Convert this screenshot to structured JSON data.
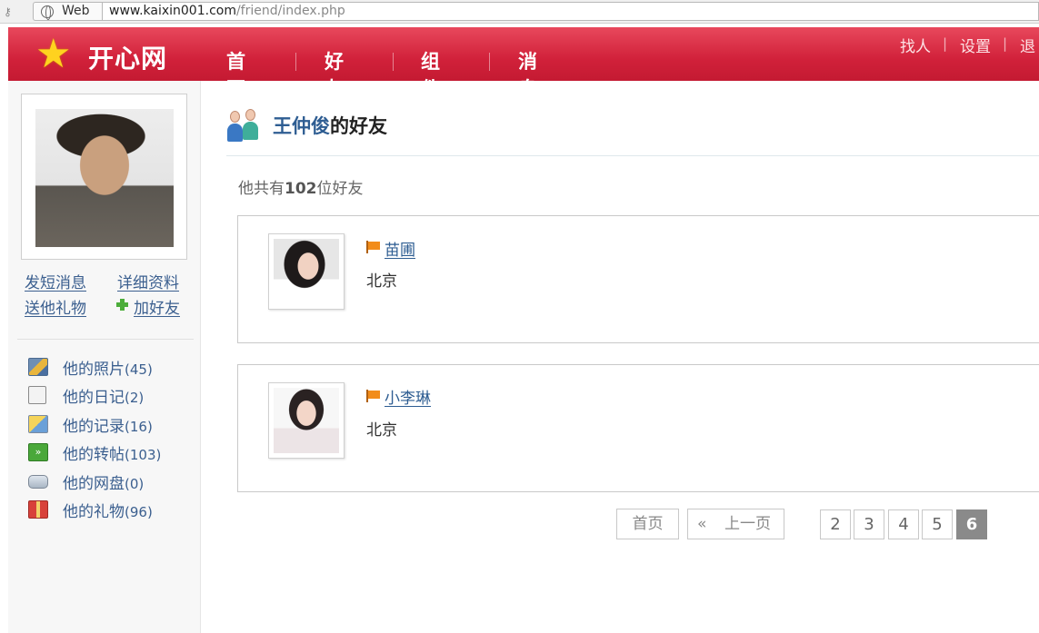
{
  "browser": {
    "mode_label": "Web",
    "url_host": "www.kaixin001.com",
    "url_path": "/friend/index.php"
  },
  "header": {
    "logo_text": "开心网",
    "nav": [
      "首页",
      "好友",
      "组件",
      "消息"
    ],
    "top_links": [
      "找人",
      "设置",
      "退"
    ],
    "colors": {
      "header_red": "#d1213a",
      "link_blue": "#2e5d92"
    }
  },
  "sidebar": {
    "actions": {
      "message": "发短消息",
      "profile": "详细资料",
      "gift": "送他礼物",
      "add_friend": "加好友"
    },
    "menu": [
      {
        "label": "他的照片",
        "count": "(45)",
        "icon": "photo-icon"
      },
      {
        "label": "他的日记",
        "count": "(2)",
        "icon": "diary-icon"
      },
      {
        "label": "他的记录",
        "count": "(16)",
        "icon": "record-icon"
      },
      {
        "label": "他的转帖",
        "count": "(103)",
        "icon": "repost-icon"
      },
      {
        "label": "他的网盘",
        "count": "(0)",
        "icon": "netdisk-icon"
      },
      {
        "label": "他的礼物",
        "count": "(96)",
        "icon": "gift-icon"
      }
    ]
  },
  "main": {
    "owner_name": "王仲俊",
    "title_suffix": "的好友",
    "count_prefix": "他共有",
    "count_value": "102",
    "count_suffix": "位好友",
    "friends": [
      {
        "name": "苗圃",
        "city": "北京"
      },
      {
        "name": "小李琳",
        "city": "北京"
      }
    ]
  },
  "pagination": {
    "first": "首页",
    "prev_arrow": "«",
    "prev": "上一页",
    "pages": [
      "2",
      "3",
      "4",
      "5",
      "6"
    ],
    "current": "6"
  }
}
